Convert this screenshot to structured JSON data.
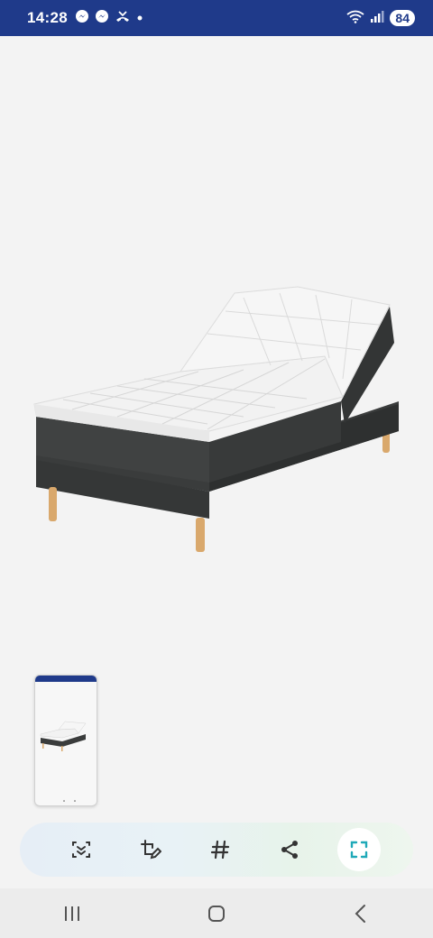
{
  "status_bar": {
    "time": "14:28",
    "battery": "84",
    "left_icons": [
      "messenger-icon",
      "messenger-icon",
      "missed-call-icon",
      "dot-icon"
    ],
    "right_icons": [
      "wifi-icon",
      "signal-icon"
    ]
  },
  "preview": {
    "image": "adjustable-bed-icon",
    "bed_frame_color": "#3a3c3c",
    "mattress_color": "#f4f4f4",
    "leg_color": "#d9a86c"
  },
  "toolbar": {
    "items": [
      {
        "name": "scan-text-icon"
      },
      {
        "name": "crop-edit-icon"
      },
      {
        "name": "hashtag-icon"
      },
      {
        "name": "share-icon"
      },
      {
        "name": "expand-icon"
      }
    ]
  },
  "nav_bar": {
    "items": [
      "recent-apps-icon",
      "home-icon",
      "back-icon"
    ]
  },
  "colors": {
    "status_bar_bg": "#1f3a8a",
    "page_bg": "#f3f3f3",
    "accent_teal": "#1fa9b8"
  }
}
